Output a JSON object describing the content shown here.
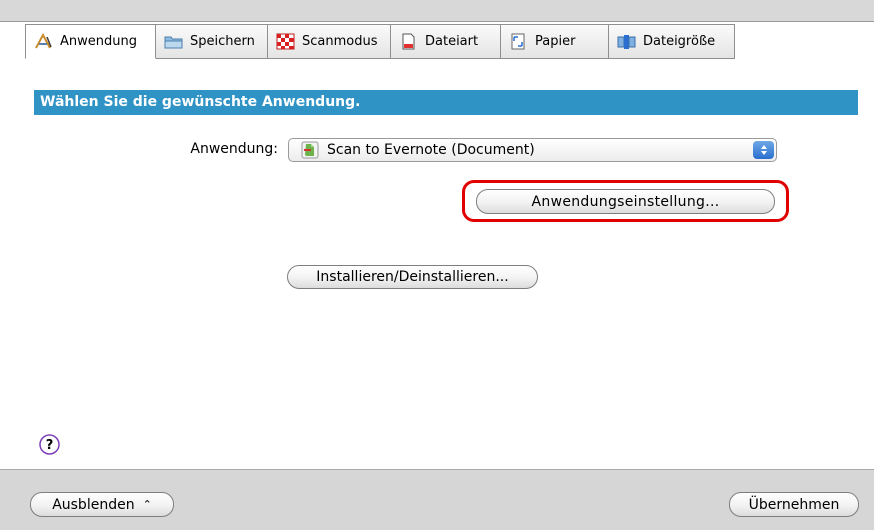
{
  "tabs": [
    {
      "label": "Anwendung",
      "icon": "application-icon",
      "active": true
    },
    {
      "label": "Speichern",
      "icon": "folder-icon",
      "active": false
    },
    {
      "label": "Scanmodus",
      "icon": "scan-mode-icon",
      "active": false
    },
    {
      "label": "Dateiart",
      "icon": "file-type-icon",
      "active": false
    },
    {
      "label": "Papier",
      "icon": "paper-icon",
      "active": false
    },
    {
      "label": "Dateigröße",
      "icon": "file-size-icon",
      "active": false
    }
  ],
  "banner": {
    "text": "Wählen Sie die gewünschte Anwendung."
  },
  "application": {
    "label": "Anwendung:",
    "selected": "Scan to Evernote (Document)",
    "icon": "evernote-icon"
  },
  "buttons": {
    "settings": "Anwendungseinstellung...",
    "install": "Installieren/Deinstallieren...",
    "hide": "Ausblenden",
    "apply": "Übernehmen"
  },
  "help": {
    "symbol": "?"
  },
  "colors": {
    "banner": "#2f93c5",
    "highlight": "#e00000",
    "stepper": "#2a6fd0",
    "help": "#7c3fb8"
  }
}
